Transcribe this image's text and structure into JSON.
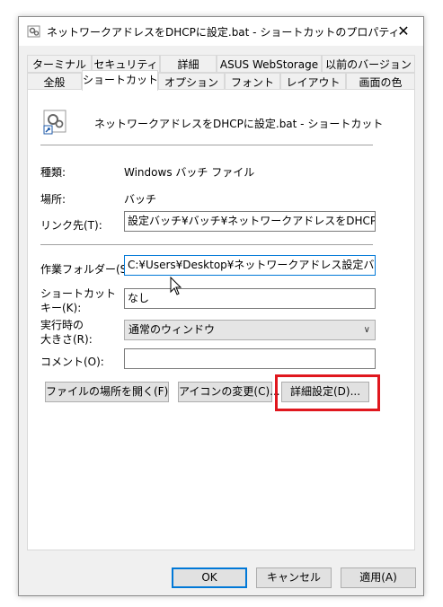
{
  "window": {
    "title": "ネットワークアドレスをDHCPに設定.bat - ショートカットのプロパティ",
    "close_glyph": "✕"
  },
  "tabs_row1": [
    "ターミナル",
    "セキュリティ",
    "詳細",
    "ASUS WebStorage",
    "以前のバージョン"
  ],
  "tabs_row2": [
    "全般",
    "ショートカット",
    "オプション",
    "フォント",
    "レイアウト",
    "画面の色"
  ],
  "active_tab": "ショートカット",
  "shortcut": {
    "name": "ネットワークアドレスをDHCPに設定.bat - ショートカット",
    "type_label": "種類:",
    "type_value": "Windows バッチ ファイル",
    "location_label": "場所:",
    "location_value": "バッチ",
    "target_label": "リンク先(T):",
    "target_value": "設定バッチ¥バッチ¥ネットワークアドレスをDHCPに設定.bat",
    "startin_label": "作業フォルダー(S):",
    "startin_value": "C:¥Users¥Desktop¥ネットワークアドレス設定バッチ¥バッチ",
    "shortcutkey_label_1": "ショートカット",
    "shortcutkey_label_2": "キー(K):",
    "shortcutkey_value": "なし",
    "run_label_1": "実行時の",
    "run_label_2": "大きさ(R):",
    "run_value": "通常のウィンドウ",
    "comment_label": "コメント(O):",
    "comment_value": ""
  },
  "buttons": {
    "open_location": "ファイルの場所を開く(F)",
    "change_icon": "アイコンの変更(C)...",
    "advanced": "詳細設定(D)...",
    "ok": "OK",
    "cancel": "キャンセル",
    "apply": "適用(A)"
  },
  "colors": {
    "highlight": "#e0171e",
    "focus": "#0078d7"
  }
}
